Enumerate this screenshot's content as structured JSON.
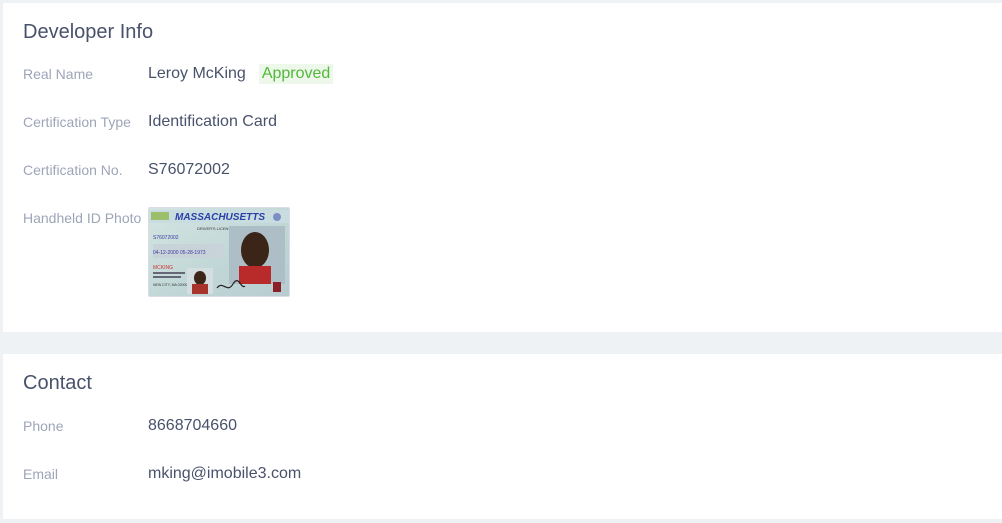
{
  "developer_info": {
    "title": "Developer Info",
    "real_name": {
      "label": "Real Name",
      "value": "Leroy McKing",
      "status": "Approved"
    },
    "certification_type": {
      "label": "Certification Type",
      "value": "Identification Card"
    },
    "certification_no": {
      "label": "Certification No.",
      "value": "S76072002"
    },
    "handheld_id_photo": {
      "label": "Handheld ID Photo",
      "card": {
        "state": "MASSACHUSETTS",
        "doc_type": "DRIVER'S LICENSE",
        "number": "S76072002",
        "dates": "04-12-2000  05-28-1973",
        "name": "MCKING",
        "address": "NEW CITY, MA  02000"
      }
    }
  },
  "contact": {
    "title": "Contact",
    "phone": {
      "label": "Phone",
      "value": "8668704660"
    },
    "email": {
      "label": "Email",
      "value": "mking@imobile3.com"
    }
  },
  "colors": {
    "page_bg": "#eff2f5",
    "card_bg": "#ffffff",
    "title_text": "#48526b",
    "label_text": "#9ea5b8",
    "approved_text": "#52b83c",
    "approved_bg": "#eef8ea"
  },
  "icons": [
    "id-card-image"
  ]
}
